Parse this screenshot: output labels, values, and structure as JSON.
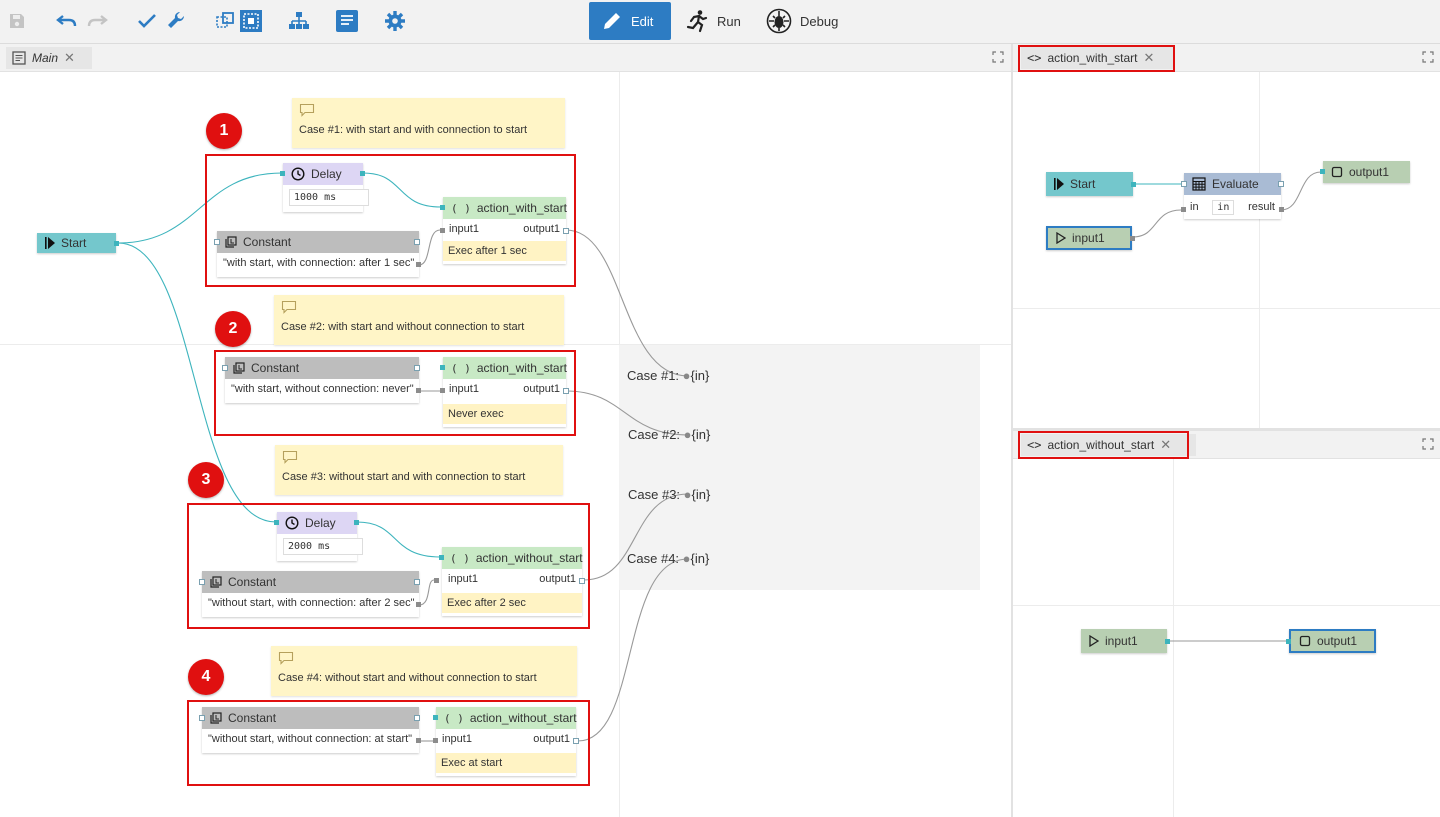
{
  "toolbar": {
    "modes": [
      {
        "label": "Edit"
      },
      {
        "label": "Run"
      },
      {
        "label": "Debug"
      }
    ]
  },
  "main_tab": {
    "label": "Main"
  },
  "panel1_tab": {
    "label": "action_with_start"
  },
  "panel2_tab": {
    "label": "action_without_start"
  },
  "main": {
    "start": {
      "label": "Start"
    },
    "case1": {
      "badge": "1",
      "comment": "Case #1: with start and with connection to start",
      "delay_label": "Delay",
      "delay_value": "1000 ms",
      "const_label": "Constant",
      "const_value": "\"with start, with connection: after 1 sec\"",
      "action_label": "action_with_start",
      "in": "input1",
      "out": "output1",
      "exec": "Exec after 1 sec"
    },
    "case2": {
      "badge": "2",
      "comment": "Case #2: with start and without connection to start",
      "const_label": "Constant",
      "const_value": "\"with start, without connection: never\"",
      "action_label": "action_with_start",
      "in": "input1",
      "out": "output1",
      "exec": "Never exec"
    },
    "case3": {
      "badge": "3",
      "comment": "Case #3: without start and with connection to start",
      "delay_label": "Delay",
      "delay_value": "2000 ms",
      "const_label": "Constant",
      "const_value": "\"without start, with connection: after 2 sec\"",
      "action_label": "action_without_start",
      "in": "input1",
      "out": "output1",
      "exec": "Exec after 2 sec"
    },
    "case4": {
      "badge": "4",
      "comment": "Case #4: without start and without connection to start",
      "const_label": "Constant",
      "const_value": "\"without start, without connection: at start\"",
      "action_label": "action_without_start",
      "in": "input1",
      "out": "output1",
      "exec": "Exec at start"
    },
    "outputs": [
      {
        "label": "Case #1:",
        "port": "{in}"
      },
      {
        "label": "Case #2:",
        "port": "{in}"
      },
      {
        "label": "Case #3:",
        "port": "{in}"
      },
      {
        "label": "Case #4:",
        "port": "{in}"
      }
    ]
  },
  "panel1": {
    "start": "Start",
    "evaluate": "Evaluate",
    "eval_in": "in",
    "eval_in_value": "in",
    "eval_result": "result",
    "input": "input1",
    "output": "output1"
  },
  "panel2": {
    "input": "input1",
    "output": "output1"
  },
  "colors": {
    "accent": "#2d7cc3",
    "highlight": "#e01010",
    "wire": "#3db4bd"
  }
}
